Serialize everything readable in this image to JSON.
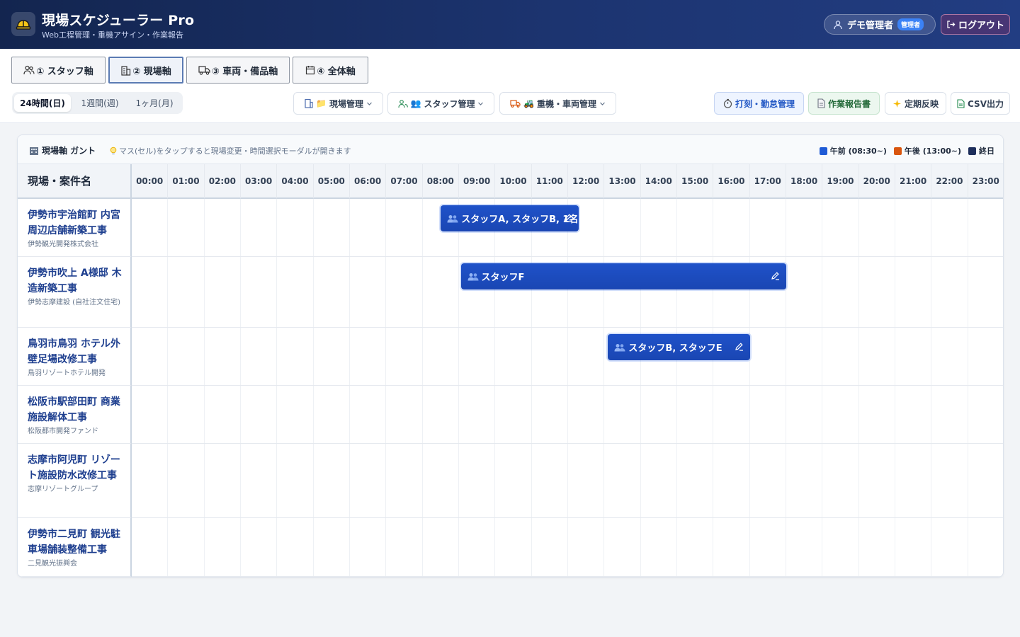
{
  "app": {
    "title": "現場スケジューラー Pro",
    "subtitle": "Web工程管理・重機アサイン・作業報告",
    "logo_icon": "hardhat-icon"
  },
  "user": {
    "name": "デモ管理者",
    "role_badge": "管理者",
    "logout_label": "ログアウト"
  },
  "axis_tabs": [
    {
      "label": "① スタッフ軸",
      "icon": "users-icon",
      "active": false
    },
    {
      "label": "② 現場軸",
      "icon": "building-icon",
      "active": true
    },
    {
      "label": "③ 車両・備品軸",
      "icon": "truck-icon",
      "active": false
    },
    {
      "label": "④ 全体軸",
      "icon": "calendar-icon",
      "active": false
    }
  ],
  "period_tabs": [
    {
      "label": "24時間(日)",
      "active": true
    },
    {
      "label": "1週間(週)",
      "active": false
    },
    {
      "label": "1ヶ月(月)",
      "active": false
    }
  ],
  "management_menus": [
    {
      "label": "現場管理",
      "emoji": "📁",
      "icon": "building-icon"
    },
    {
      "label": "スタッフ管理",
      "emoji": "👥",
      "icon": "users-icon"
    },
    {
      "label": "重機・車両管理",
      "emoji": "🚜",
      "icon": "truck-icon"
    }
  ],
  "actions": {
    "attendance": "打刻・勤怠管理",
    "work_report": "作業報告書",
    "regular_apply": "定期反映",
    "csv_export": "CSV出力"
  },
  "gantt": {
    "title": "現場軸 ガント",
    "hint": "マス(セル)をタップすると現場変更・時間選択モーダルが開きます",
    "legend": [
      {
        "label": "午前 (08:30~)",
        "color": "#1f5bd6"
      },
      {
        "label": "午後 (13:00~)",
        "color": "#d9560f"
      },
      {
        "label": "終日",
        "color": "#1e2f5c"
      }
    ],
    "column_header": "現場・案件名",
    "hours": [
      "00:00",
      "01:00",
      "02:00",
      "03:00",
      "04:00",
      "05:00",
      "06:00",
      "07:00",
      "08:00",
      "09:00",
      "10:00",
      "11:00",
      "12:00",
      "13:00",
      "14:00",
      "15:00",
      "16:00",
      "17:00",
      "18:00",
      "19:00",
      "20:00",
      "21:00",
      "22:00",
      "23:00"
    ],
    "sites": [
      {
        "name": "伊勢市宇治館町 内宮周辺店舗新築工事",
        "client": "伊勢観光開発株式会社"
      },
      {
        "name": "伊勢市吹上 A様邸 木造新築工事",
        "client": "伊勢志摩建設 (自社注文住宅)"
      },
      {
        "name": "鳥羽市鳥羽 ホテル外壁足場改修工事",
        "client": "鳥羽リゾートホテル開発"
      },
      {
        "name": "松阪市駅部田町 商業施設解体工事",
        "client": "松阪都市開発ファンド"
      },
      {
        "name": "志摩市阿児町 リゾート施設防水改修工事",
        "client": "志摩リゾートグループ"
      },
      {
        "name": "伊勢市二見町 観光駐車場舗装整備工事",
        "client": "二見観光振興会"
      }
    ],
    "assignments": [
      {
        "row": 0,
        "start_hour": 8.5,
        "end_hour": 12.3,
        "label": "スタッフA, スタッフB, 1名"
      },
      {
        "row": 1,
        "start_hour": 9.05,
        "end_hour": 18.0,
        "label": "スタッフF"
      },
      {
        "row": 2,
        "start_hour": 13.1,
        "end_hour": 17.0,
        "label": "スタッフB, スタッフE"
      }
    ]
  },
  "colors": {
    "header_bg": "#1a2e66",
    "bar": "#1f52c9",
    "site_name": "#1e3f8f"
  }
}
